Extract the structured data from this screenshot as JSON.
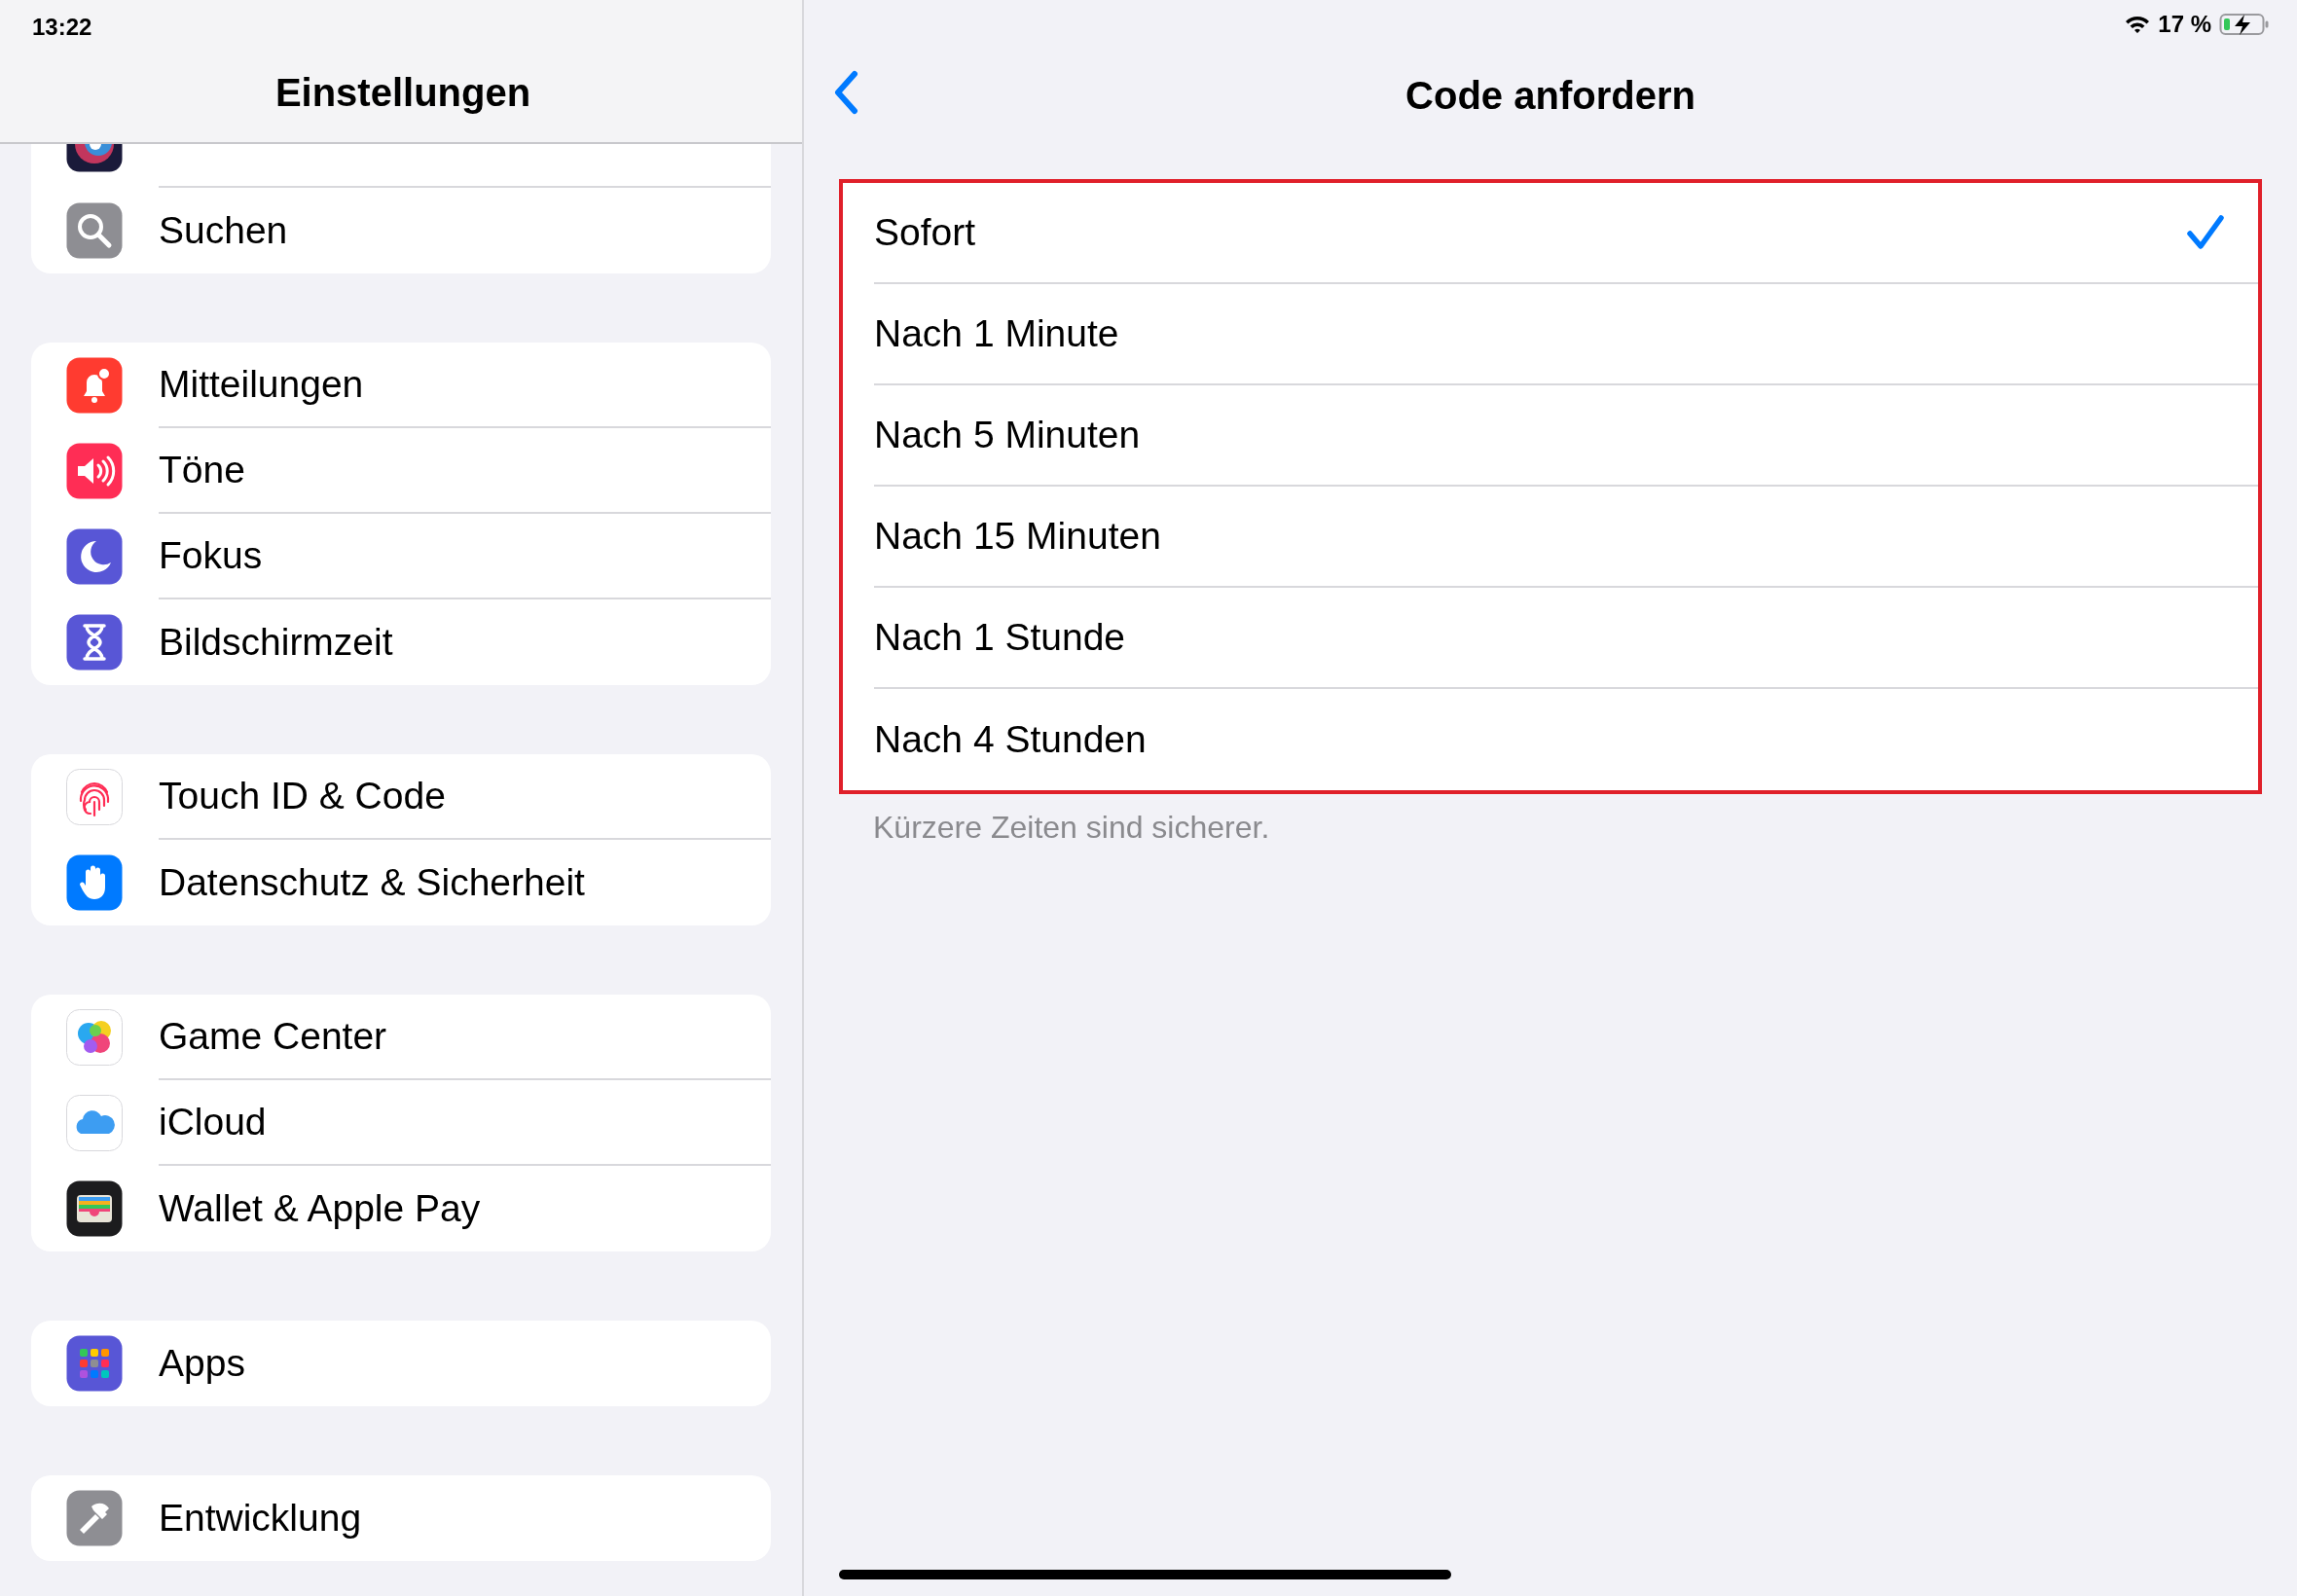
{
  "status_bar": {
    "time": "13:22",
    "battery_text": "17 %"
  },
  "sidebar": {
    "title": "Einstellungen",
    "groups": [
      [
        {
          "kind": "siri",
          "partial": true
        },
        {
          "label": "Suchen",
          "kind": "search"
        }
      ],
      [
        {
          "label": "Mitteilungen",
          "kind": "bell"
        },
        {
          "label": "Töne",
          "kind": "speaker"
        },
        {
          "label": "Fokus",
          "kind": "moon"
        },
        {
          "label": "Bildschirmzeit",
          "kind": "hourglass"
        }
      ],
      [
        {
          "label": "Touch ID & Code",
          "kind": "fingerprint"
        },
        {
          "label": "Datenschutz & Sicherheit",
          "kind": "hand"
        }
      ],
      [
        {
          "label": "Game Center",
          "kind": "bubbles"
        },
        {
          "label": "iCloud",
          "kind": "cloud"
        },
        {
          "label": "Wallet & Apple Pay",
          "kind": "wallet"
        }
      ],
      [
        {
          "label": "Apps",
          "kind": "grid"
        }
      ],
      [
        {
          "label": "Entwicklung",
          "kind": "hammer"
        }
      ]
    ]
  },
  "detail": {
    "title": "Code anfordern",
    "options": [
      {
        "label": "Sofort",
        "selected": true
      },
      {
        "label": "Nach 1 Minute",
        "selected": false
      },
      {
        "label": "Nach 5 Minuten",
        "selected": false
      },
      {
        "label": "Nach 15 Minuten",
        "selected": false
      },
      {
        "label": "Nach 1 Stunde",
        "selected": false
      },
      {
        "label": "Nach 4 Stunden",
        "selected": false
      }
    ],
    "footer": "Kürzere Zeiten sind sicherer."
  }
}
